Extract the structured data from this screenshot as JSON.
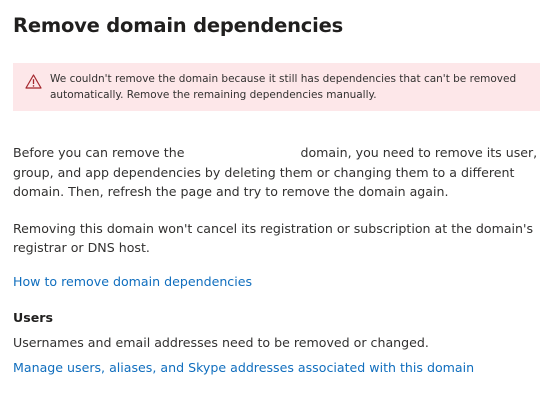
{
  "page": {
    "title": "Remove domain dependencies"
  },
  "error": {
    "icon": "warning-triangle-icon",
    "message": "We couldn't remove the domain because it still has dependencies that can't be removed automatically. Remove the remaining dependencies manually.",
    "background_color": "#fde7e9",
    "icon_color": "#a4262c"
  },
  "intro": {
    "before_domain": "Before you can remove the",
    "after_domain": "domain, you need to remove its user, group, and app dependencies by deleting them or changing them to a different domain. Then, refresh the page and try to remove the domain again."
  },
  "registration_note": "Removing this domain won't cancel its registration or subscription at the domain's registrar or DNS host.",
  "help_link": "How to remove domain dependencies",
  "users_section": {
    "heading": "Users",
    "description": "Usernames and email addresses need to be removed or changed.",
    "link": "Manage users, aliases, and Skype addresses associated with this domain"
  },
  "colors": {
    "link": "#106ebe",
    "text": "#323130"
  }
}
